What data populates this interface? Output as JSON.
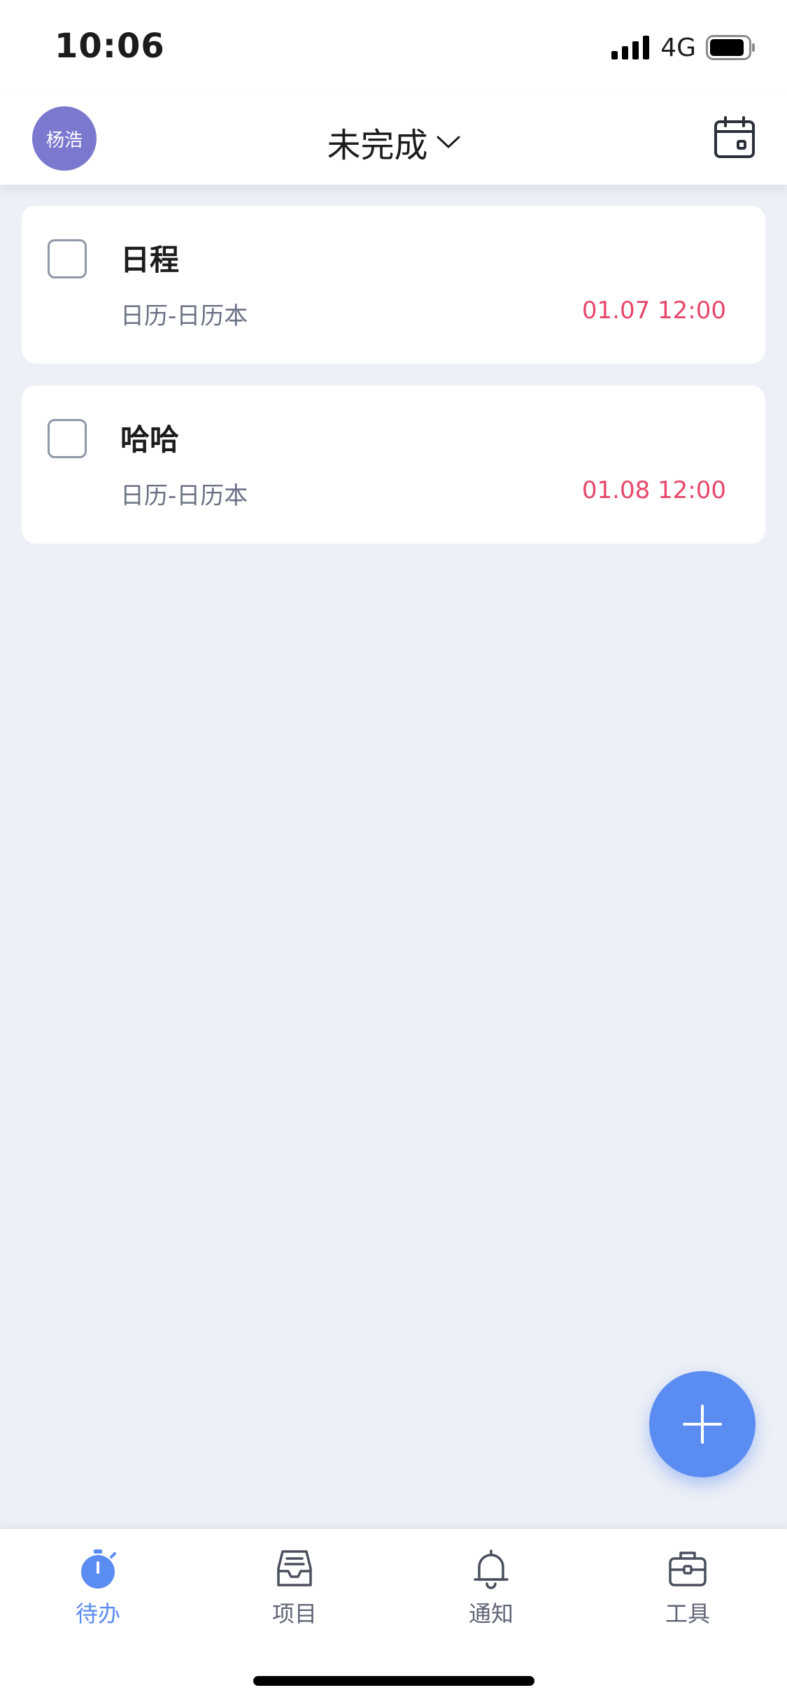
{
  "status_bar": {
    "time": "10:06",
    "network": "4G"
  },
  "header": {
    "avatar_text": "杨浩",
    "title": "未完成"
  },
  "tasks": [
    {
      "title": "日程",
      "calendar": "日历-日历本",
      "due": "01.07 12:00"
    },
    {
      "title": "哈哈",
      "calendar": "日历-日历本",
      "due": "01.08 12:00"
    }
  ],
  "tabs": [
    {
      "label": "待办",
      "icon": "stopwatch-icon",
      "active": true
    },
    {
      "label": "项目",
      "icon": "inbox-icon",
      "active": false
    },
    {
      "label": "通知",
      "icon": "bell-icon",
      "active": false
    },
    {
      "label": "工具",
      "icon": "toolbox-icon",
      "active": false
    }
  ],
  "colors": {
    "accent": "#5b8cf2",
    "avatar": "#7b78cf",
    "due_date": "#e8476a",
    "background": "#edf0f6"
  }
}
